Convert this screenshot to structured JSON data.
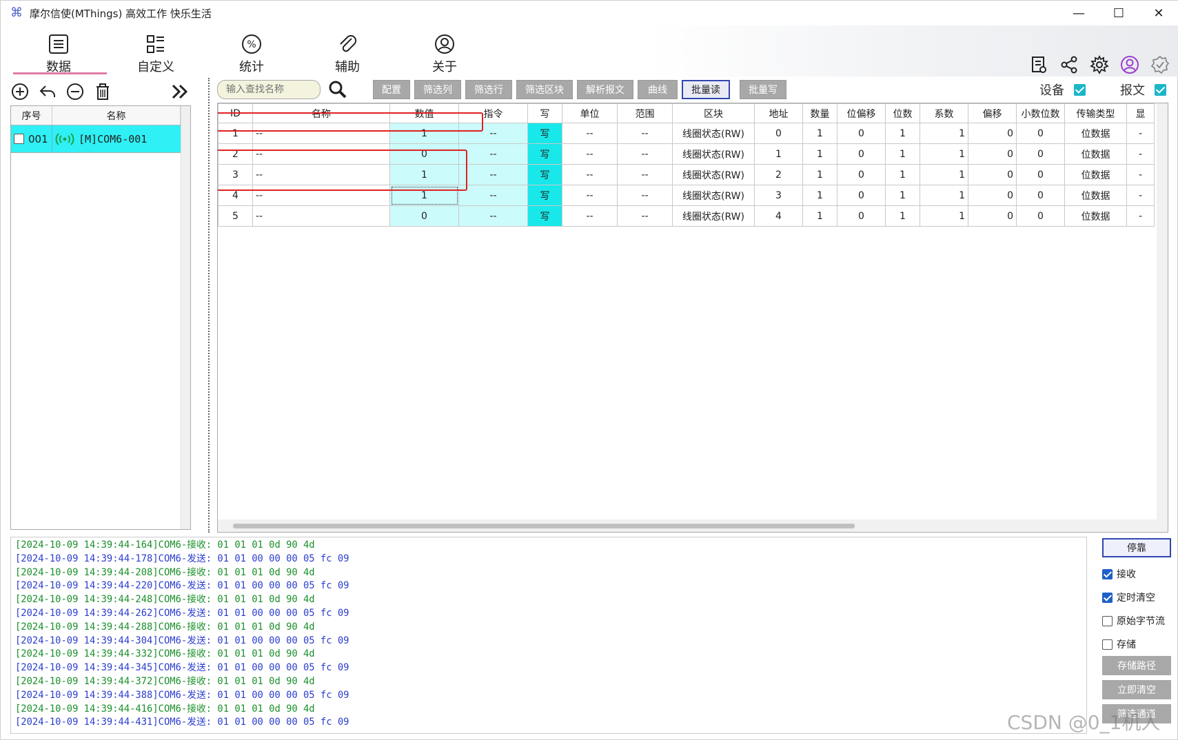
{
  "window": {
    "title": "摩尔信使(MThings) 高效工作 快乐生活",
    "minimize": "—",
    "maximize": "☐",
    "close": "✕"
  },
  "nav": {
    "items": [
      {
        "label": "数据",
        "icon": "list-icon"
      },
      {
        "label": "自定义",
        "icon": "grid-list-icon"
      },
      {
        "label": "统计",
        "icon": "percent-icon"
      },
      {
        "label": "辅助",
        "icon": "paperclip-icon"
      },
      {
        "label": "关于",
        "icon": "user-icon"
      }
    ],
    "right_icons": [
      "document-icon",
      "share-icon",
      "gear-icon",
      "user-circle-icon",
      "badge-check-icon"
    ],
    "device_label": "设备",
    "message_label": "报文"
  },
  "left_panel": {
    "header_seq": "序号",
    "header_name": "名称",
    "rows": [
      {
        "seq": "001",
        "name": "[M]COM6-001"
      }
    ]
  },
  "filterbar": {
    "search_placeholder": "输入查找名称",
    "buttons": [
      "配置",
      "筛选列",
      "筛选行",
      "筛选区块",
      "解析报文",
      "曲线",
      "批量读",
      "批量写"
    ]
  },
  "grid": {
    "headers": [
      "ID",
      "名称",
      "数值",
      "指令",
      "写",
      "单位",
      "范围",
      "区块",
      "地址",
      "数量",
      "位偏移",
      "位数",
      "系数",
      "偏移",
      "小数位数",
      "传输类型",
      "显"
    ],
    "rows": [
      [
        "1",
        "--",
        "1",
        "--",
        "写",
        "--",
        "--",
        "线圈状态(RW)",
        "0",
        "1",
        "0",
        "1",
        "1",
        "0",
        "0",
        "位数据",
        "-"
      ],
      [
        "2",
        "--",
        "0",
        "--",
        "写",
        "--",
        "--",
        "线圈状态(RW)",
        "1",
        "1",
        "0",
        "1",
        "1",
        "0",
        "0",
        "位数据",
        "-"
      ],
      [
        "3",
        "--",
        "1",
        "--",
        "写",
        "--",
        "--",
        "线圈状态(RW)",
        "2",
        "1",
        "0",
        "1",
        "1",
        "0",
        "0",
        "位数据",
        "-"
      ],
      [
        "4",
        "--",
        "1",
        "--",
        "写",
        "--",
        "--",
        "线圈状态(RW)",
        "3",
        "1",
        "0",
        "1",
        "1",
        "0",
        "0",
        "位数据",
        "-"
      ],
      [
        "5",
        "--",
        "0",
        "--",
        "写",
        "--",
        "--",
        "线圈状态(RW)",
        "4",
        "1",
        "0",
        "1",
        "1",
        "0",
        "0",
        "位数据",
        "-"
      ]
    ]
  },
  "log": [
    {
      "type": "recv",
      "text": "[2024-10-09 14:39:44-164]COM6-接收: 01 01 01 0d 90 4d"
    },
    {
      "type": "send",
      "text": "[2024-10-09 14:39:44-178]COM6-发送: 01 01 00 00 00 05 fc 09"
    },
    {
      "type": "recv",
      "text": "[2024-10-09 14:39:44-208]COM6-接收: 01 01 01 0d 90 4d"
    },
    {
      "type": "send",
      "text": "[2024-10-09 14:39:44-220]COM6-发送: 01 01 00 00 00 05 fc 09"
    },
    {
      "type": "recv",
      "text": "[2024-10-09 14:39:44-248]COM6-接收: 01 01 01 0d 90 4d"
    },
    {
      "type": "send",
      "text": "[2024-10-09 14:39:44-262]COM6-发送: 01 01 00 00 00 05 fc 09"
    },
    {
      "type": "recv",
      "text": "[2024-10-09 14:39:44-288]COM6-接收: 01 01 01 0d 90 4d"
    },
    {
      "type": "send",
      "text": "[2024-10-09 14:39:44-304]COM6-发送: 01 01 00 00 00 05 fc 09"
    },
    {
      "type": "recv",
      "text": "[2024-10-09 14:39:44-332]COM6-接收: 01 01 01 0d 90 4d"
    },
    {
      "type": "send",
      "text": "[2024-10-09 14:39:44-345]COM6-发送: 01 01 00 00 00 05 fc 09"
    },
    {
      "type": "recv",
      "text": "[2024-10-09 14:39:44-372]COM6-接收: 01 01 01 0d 90 4d"
    },
    {
      "type": "send",
      "text": "[2024-10-09 14:39:44-388]COM6-发送: 01 01 00 00 00 05 fc 09"
    },
    {
      "type": "recv",
      "text": "[2024-10-09 14:39:44-416]COM6-接收: 01 01 01 0d 90 4d"
    },
    {
      "type": "send",
      "text": "[2024-10-09 14:39:44-431]COM6-发送: 01 01 00 00 00 05 fc 09"
    }
  ],
  "side": {
    "stop": "停靠",
    "receive": "接收",
    "timed_clear": "定时清空",
    "raw_stream": "原始字节流",
    "store": "存储",
    "store_path": "存储路径",
    "clear_now": "立即清空",
    "filter_channel": "筛选通道"
  },
  "watermark": "CSDN @0_1机人",
  "colors": {
    "row_cyan": "#2ff0f4",
    "write_cell": "#18e8ea",
    "value_cell": "#ccfbfb",
    "highlight_red": "#e02020",
    "log_recv": "#1a8f2a",
    "log_send": "#2b3dcf"
  }
}
